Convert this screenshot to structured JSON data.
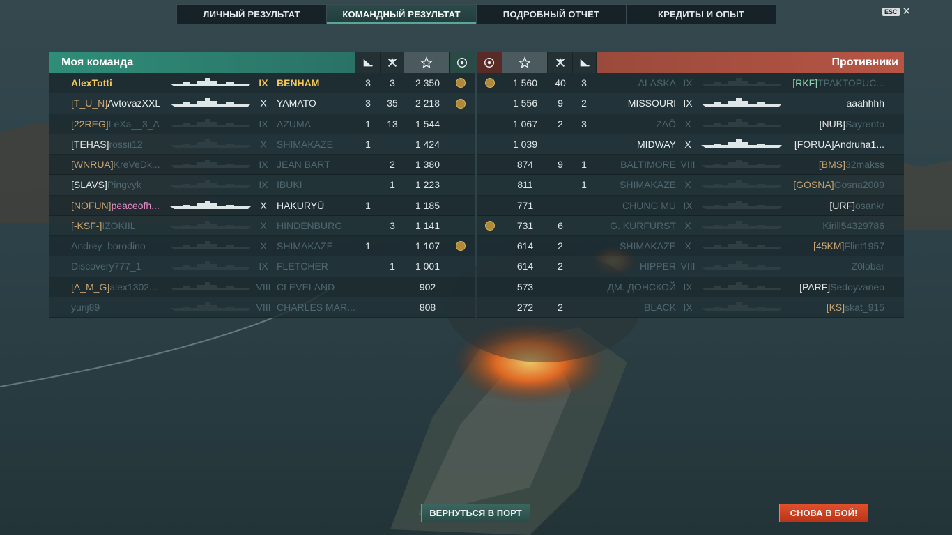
{
  "tabs": [
    "Личный результат",
    "Командный результат",
    "Подробный отчёт",
    "Кредиты и опыт"
  ],
  "active_tab": 1,
  "esc_label": "ESC",
  "close_symbol": "✕",
  "left_title": "Моя команда",
  "right_title": "Противники",
  "header_icons": [
    "ship-kill-icon",
    "plane-kill-icon",
    "star-score-icon",
    "base-capture-icon"
  ],
  "my_team": [
    {
      "clan": "",
      "name": "AlexTotti",
      "tier": "IX",
      "ship": "BENHAM",
      "kills": "3",
      "planes": "3",
      "score": "2 350",
      "medal": true,
      "state": "me"
    },
    {
      "clan": "[T_U_N]",
      "name": "AvtovazXXL",
      "tier": "X",
      "ship": "YAMATO",
      "kills": "3",
      "planes": "35",
      "score": "2 218",
      "medal": true,
      "state": "alive"
    },
    {
      "clan": "[22REG]",
      "name": "LeXa__3_A",
      "tier": "IX",
      "ship": "AZUMA",
      "kills": "1",
      "planes": "13",
      "score": "1 544",
      "medal": false,
      "state": "dead"
    },
    {
      "clan": "[TEHAS]",
      "name": "rossii12",
      "tier": "X",
      "ship": "SHIMAKAZE",
      "kills": "1",
      "planes": "",
      "score": "1 424",
      "medal": false,
      "state": "dead"
    },
    {
      "clan": "[WNRUA]",
      "name": "KreVeDk...",
      "tier": "IX",
      "ship": "JEAN BART",
      "kills": "",
      "planes": "2",
      "score": "1 380",
      "medal": false,
      "state": "dead"
    },
    {
      "clan": "[SLAVS]",
      "name": "Pingvyk",
      "tier": "IX",
      "ship": "IBUKI",
      "kills": "",
      "planes": "1",
      "score": "1 223",
      "medal": false,
      "state": "dead"
    },
    {
      "clan": "[NOFUN]",
      "name": "peaceofh...",
      "tier": "X",
      "ship": "HAKURYŪ",
      "kills": "1",
      "planes": "",
      "score": "1 185",
      "medal": false,
      "state": "alive-pink"
    },
    {
      "clan": "[-KSF-]",
      "name": "IZOKIIL",
      "tier": "X",
      "ship": "HINDENBURG",
      "kills": "",
      "planes": "3",
      "score": "1 141",
      "medal": false,
      "state": "dead"
    },
    {
      "clan": "",
      "name": "Andrey_borodino",
      "tier": "X",
      "ship": "SHIMAKAZE",
      "kills": "1",
      "planes": "",
      "score": "1 107",
      "medal": true,
      "state": "dead"
    },
    {
      "clan": "",
      "name": "Discovery777_1",
      "tier": "IX",
      "ship": "FLETCHER",
      "kills": "",
      "planes": "1",
      "score": "1 001",
      "medal": false,
      "state": "dead"
    },
    {
      "clan": "[A_M_G]",
      "name": "alex1302...",
      "tier": "VIII",
      "ship": "CLEVELAND",
      "kills": "",
      "planes": "",
      "score": "902",
      "medal": false,
      "state": "dead"
    },
    {
      "clan": "",
      "name": "yurij89",
      "tier": "VIII",
      "ship": "CHARLES MAR...",
      "kills": "",
      "planes": "",
      "score": "808",
      "medal": false,
      "state": "dead"
    }
  ],
  "enemy_team": [
    {
      "medal": true,
      "score": "1 560",
      "planes": "40",
      "kills": "3",
      "ship": "ALASKA",
      "tier": "IX",
      "clan": "[RKF]",
      "name": "TPAKTOPUC...",
      "state": "dead",
      "clan_color": "g"
    },
    {
      "medal": false,
      "score": "1 556",
      "planes": "9",
      "kills": "2",
      "ship": "MISSOURI",
      "tier": "IX",
      "clan": "",
      "name": "aaahhhh",
      "state": "alive",
      "clan_color": "w"
    },
    {
      "medal": false,
      "score": "1 067",
      "planes": "2",
      "kills": "3",
      "ship": "ZAŌ",
      "tier": "X",
      "clan": "[NUB]",
      "name": "Sayrento",
      "state": "dead",
      "clan_color": "w"
    },
    {
      "medal": false,
      "score": "1 039",
      "planes": "",
      "kills": "",
      "ship": "MIDWAY",
      "tier": "X",
      "clan": "[FORUA]",
      "name": "Andruha1...",
      "state": "alive",
      "clan_color": "w"
    },
    {
      "medal": false,
      "score": "874",
      "planes": "9",
      "kills": "1",
      "ship": "BALTIMORE",
      "tier": "VIII",
      "clan": "[BMS]",
      "name": "32makss",
      "state": "dead",
      "clan_color": "o"
    },
    {
      "medal": false,
      "score": "811",
      "planes": "",
      "kills": "1",
      "ship": "SHIMAKAZE",
      "tier": "X",
      "clan": "[GOSNA]",
      "name": "Gosna2009",
      "state": "dead",
      "clan_color": "o"
    },
    {
      "medal": false,
      "score": "771",
      "planes": "",
      "kills": "",
      "ship": "CHUNG MU",
      "tier": "IX",
      "clan": "[URF]",
      "name": "osankr",
      "state": "dead",
      "clan_color": "w"
    },
    {
      "medal": true,
      "score": "731",
      "planes": "6",
      "kills": "",
      "ship": "G. KURFÜRST",
      "tier": "X",
      "clan": "",
      "name": "Kirill54329786",
      "state": "dead",
      "clan_color": "w"
    },
    {
      "medal": false,
      "score": "614",
      "planes": "2",
      "kills": "",
      "ship": "SHIMAKAZE",
      "tier": "X",
      "clan": "[45KM]",
      "name": "Flint1957",
      "state": "dead",
      "clan_color": "c"
    },
    {
      "medal": false,
      "score": "614",
      "planes": "2",
      "kills": "",
      "ship": "HIPPER",
      "tier": "VIII",
      "clan": "",
      "name": "Z0lobar",
      "state": "dead",
      "clan_color": "w"
    },
    {
      "medal": false,
      "score": "573",
      "planes": "",
      "kills": "",
      "ship": "ДМ. ДОНСКОЙ",
      "tier": "IX",
      "clan": "[PARF]",
      "name": "Sedoyvaneo",
      "state": "dead",
      "clan_color": "w"
    },
    {
      "medal": false,
      "score": "272",
      "planes": "2",
      "kills": "",
      "ship": "BLACK",
      "tier": "IX",
      "clan": "[KS]",
      "name": "skat_915",
      "state": "dead",
      "clan_color": "o"
    }
  ],
  "buttons": {
    "port": "Вернуться в порт",
    "battle": "Снова в бой!"
  },
  "colors": {
    "ally_header": "#2f8d78",
    "enemy_header": "#b75545",
    "me": "#f3c855",
    "clan": "#c8a36f",
    "battle_button": "#d8452a"
  }
}
